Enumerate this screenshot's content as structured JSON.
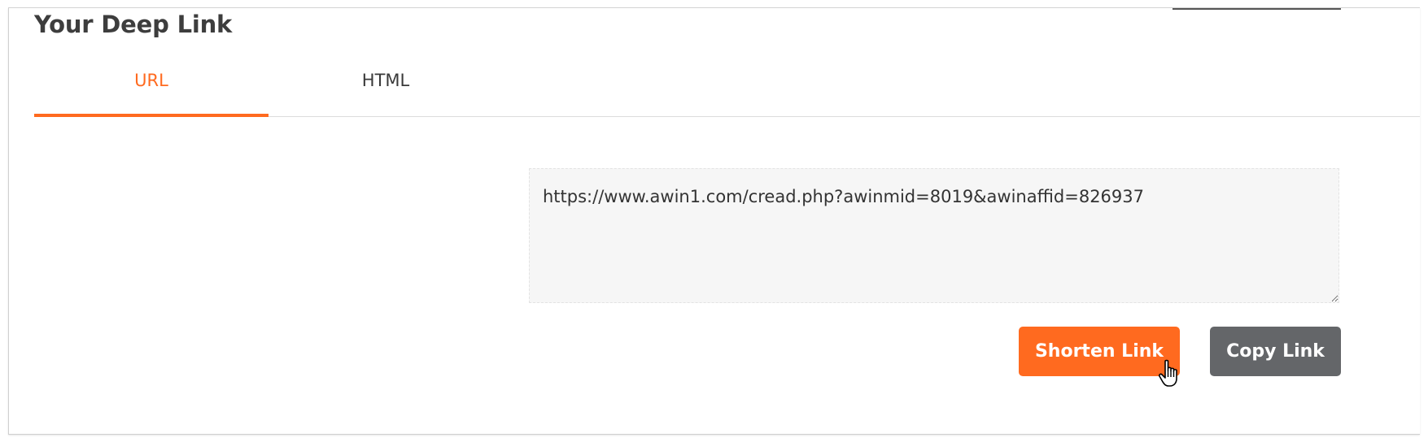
{
  "section": {
    "title": "Your Deep Link"
  },
  "tabs": [
    {
      "label": "URL",
      "active": true
    },
    {
      "label": "HTML",
      "active": false
    }
  ],
  "link": {
    "value": "https://www.awin1.com/cread.php?awinmid=8019&awinaffid=826937"
  },
  "buttons": {
    "shorten_label": "Shorten Link",
    "copy_label": "Copy Link"
  },
  "colors": {
    "accent": "#ff6a1f",
    "secondary_button": "#646669",
    "heading": "#3d3d3d",
    "input_background": "#f6f6f6"
  },
  "icons": {
    "cursor": "hand-pointer-icon"
  }
}
